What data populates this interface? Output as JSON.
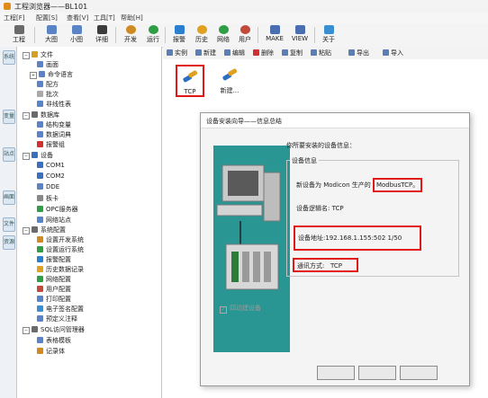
{
  "app": {
    "title": "工程浏览器——BL101"
  },
  "menu": [
    "工程[F]",
    "配置[S]",
    "查看[V]",
    "工具[T]",
    "帮助[H]"
  ],
  "toolbar": [
    {
      "label": "工程",
      "icon": "tools-icon",
      "color": "#6a6a6a"
    },
    {
      "label": "大图",
      "icon": "large-icons-view-icon",
      "color": "#5a84c6"
    },
    {
      "label": "小图",
      "icon": "small-icons-view-icon",
      "color": "#5a84c6"
    },
    {
      "label": "详细",
      "icon": "detail-view-icon",
      "color": "#3c3c3c"
    },
    {
      "label": "开发",
      "icon": "develop-icon",
      "color": "#d08a22"
    },
    {
      "label": "运行",
      "icon": "run-icon",
      "color": "#2f9e44"
    },
    {
      "label": "报警",
      "icon": "alarm-icon",
      "color": "#2a7fd0"
    },
    {
      "label": "历史",
      "icon": "history-icon",
      "color": "#e0a020"
    },
    {
      "label": "网络",
      "icon": "network-icon",
      "color": "#2f9e44"
    },
    {
      "label": "用户",
      "icon": "user-icon",
      "color": "#c24a3a"
    },
    {
      "label": "MAKE",
      "icon": "make-icon",
      "color": "#4a6fb0"
    },
    {
      "label": "VIEW",
      "icon": "view-icon",
      "color": "#4a6fb0"
    },
    {
      "label": "关于",
      "icon": "about-icon",
      "color": "#3a8fd0"
    }
  ],
  "vtabs": [
    "系统",
    "变量",
    "站点",
    "画面",
    "文件",
    "资源"
  ],
  "tree": [
    {
      "label": "文件",
      "level": 0,
      "exp": "−",
      "color": "#d4a020"
    },
    {
      "label": "画面",
      "level": 1,
      "color": "#5a84c6"
    },
    {
      "label": "命令语言",
      "level": 1,
      "exp": "+",
      "color": "#5a84c6"
    },
    {
      "label": "配方",
      "level": 1,
      "color": "#5a84c6"
    },
    {
      "label": "批次",
      "level": 1,
      "color": "#aaaaaa"
    },
    {
      "label": "非线性表",
      "level": 1,
      "color": "#5a84c6"
    },
    {
      "label": "数据库",
      "level": 0,
      "exp": "−",
      "color": "#6a6a6a"
    },
    {
      "label": "结构变量",
      "level": 1,
      "color": "#5a84c6"
    },
    {
      "label": "数据词典",
      "level": 1,
      "color": "#5a84c6"
    },
    {
      "label": "报警组",
      "level": 1,
      "color": "#d03030"
    },
    {
      "label": "设备",
      "level": 0,
      "exp": "−",
      "color": "#3a6fc0"
    },
    {
      "label": "COM1",
      "level": 1,
      "color": "#3a6fc0"
    },
    {
      "label": "COM2",
      "level": 1,
      "color": "#3a6fc0"
    },
    {
      "label": "DDE",
      "level": 1,
      "color": "#5a84c6"
    },
    {
      "label": "板卡",
      "level": 1,
      "color": "#888888"
    },
    {
      "label": "OPC服务器",
      "level": 1,
      "color": "#2f9e44"
    },
    {
      "label": "网络站点",
      "level": 1,
      "color": "#5a84c6"
    },
    {
      "label": "系统配置",
      "level": 0,
      "exp": "−",
      "color": "#6a6a6a"
    },
    {
      "label": "设置开发系统",
      "level": 1,
      "color": "#d08a22"
    },
    {
      "label": "设置运行系统",
      "level": 1,
      "color": "#2f9e44"
    },
    {
      "label": "报警配置",
      "level": 1,
      "color": "#2a7fd0"
    },
    {
      "label": "历史数据记录",
      "level": 1,
      "color": "#e0a020"
    },
    {
      "label": "网络配置",
      "level": 1,
      "color": "#2f9e44"
    },
    {
      "label": "用户配置",
      "level": 1,
      "color": "#c24a3a"
    },
    {
      "label": "打印配置",
      "level": 1,
      "color": "#5a84c6"
    },
    {
      "label": "电子签名配置",
      "level": 1,
      "color": "#3a8fd0"
    },
    {
      "label": "预定义注释",
      "level": 1,
      "color": "#5a84c6"
    },
    {
      "label": "SQL访问管理器",
      "level": 0,
      "exp": "−",
      "color": "#6a6a6a"
    },
    {
      "label": "表格模板",
      "level": 1,
      "color": "#5a84c6"
    },
    {
      "label": "记录体",
      "level": 1,
      "color": "#d08a22"
    }
  ],
  "right_toolbar": [
    "实例",
    "新建",
    "编辑",
    "删除",
    "复制",
    "粘贴",
    "导出",
    "导入"
  ],
  "devices": [
    {
      "label": "TCP",
      "icon": "device-icon",
      "highlighted": true
    },
    {
      "label": "新建...",
      "icon": "new-device-icon",
      "highlighted": false
    }
  ],
  "dialog": {
    "title": "设备安装向导——信息总结",
    "prompt": "你所要安装的设备信息：",
    "group_title": "设备信息",
    "line1_prefix": "新设备为 Modicon 生产的",
    "line1_value": "ModbusTCP",
    "line1_suffix": "。",
    "line2": "设备逻辑名: TCP",
    "line3": "设备地址:192.168.1.155:502 1/50",
    "line4_label": "通讯方式:",
    "line4_value": "TCP",
    "checkbox": "四动建设备",
    "buttons": [
      "",
      "",
      ""
    ]
  }
}
